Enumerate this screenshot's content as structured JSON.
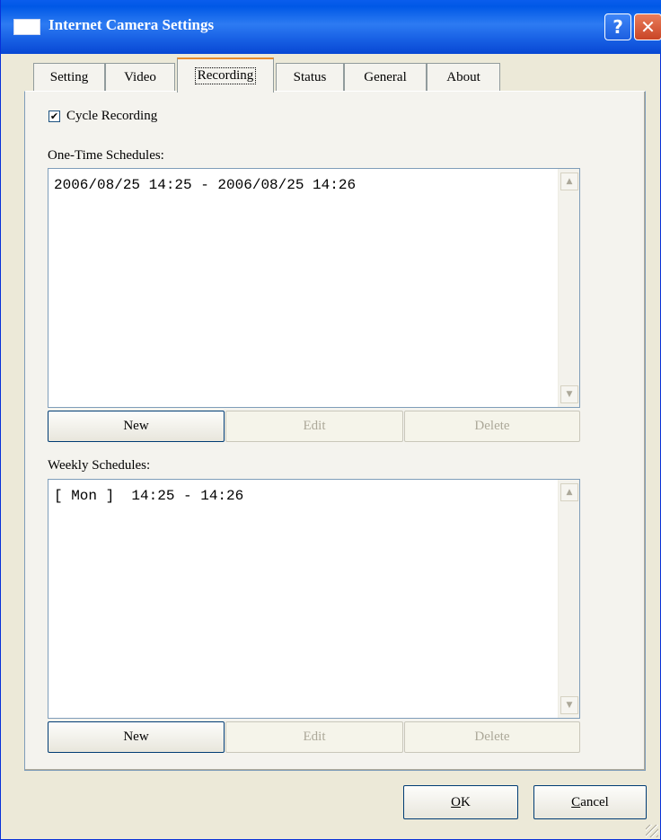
{
  "window": {
    "title": "Internet Camera Settings",
    "help_label": "?",
    "close_label": "✕"
  },
  "tabs": [
    {
      "label": "Setting"
    },
    {
      "label": "Video"
    },
    {
      "label": "Recording",
      "active": true
    },
    {
      "label": "Status"
    },
    {
      "label": "General"
    },
    {
      "label": "About"
    }
  ],
  "recording": {
    "cycle_recording": {
      "label": "Cycle Recording",
      "checked": true,
      "check_mark": "✔"
    },
    "one_time": {
      "label": "One-Time Schedules:",
      "items": [
        "2006/08/25 14:25 - 2006/08/25 14:26"
      ],
      "new_label": "New",
      "edit_label": "Edit",
      "delete_label": "Delete"
    },
    "weekly": {
      "label": "Weekly Schedules:",
      "items": [
        "[ Mon ]  14:25 - 14:26"
      ],
      "new_label": "New",
      "edit_label": "Edit",
      "delete_label": "Delete"
    }
  },
  "footer": {
    "ok_label": "OK",
    "ok_accel": "O",
    "ok_rest": "K",
    "cancel_label": "Cancel",
    "cancel_accel": "C",
    "cancel_rest": "ancel"
  },
  "icons": {
    "scroll_up": "▲",
    "scroll_down": "▼"
  }
}
